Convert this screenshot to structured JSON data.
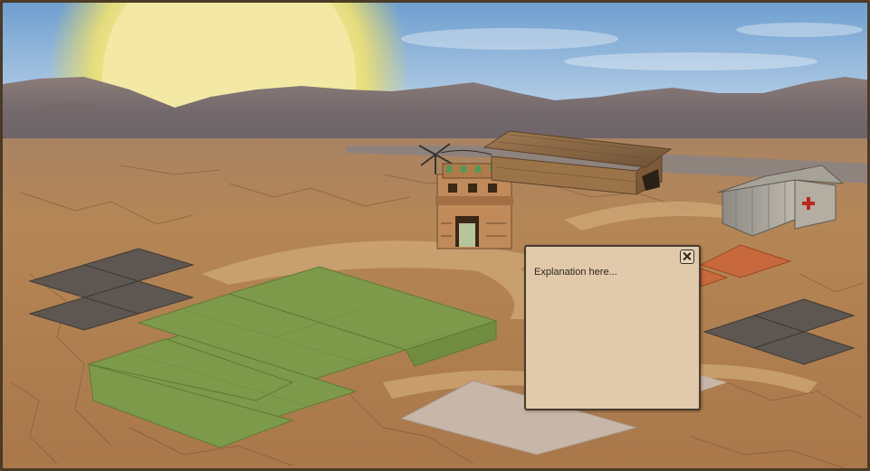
{
  "scene": {
    "sky_color": "#8fb3d9",
    "sun_color": "#f2e58a",
    "ground_color": "#b07f4e",
    "crop_color": "#7d9a4a",
    "stone_color": "#5e5650",
    "brick_color": "#c8683d",
    "gravel_color": "#c8b6a8",
    "objects": [
      "sun",
      "mountains",
      "road",
      "crop-field",
      "stone-plots",
      "brick-plot",
      "gravel-plot",
      "watch-tower",
      "barn",
      "medical-tent",
      "windmill"
    ]
  },
  "explanation_popup": {
    "text": "Explanation here...",
    "close_icon": "close-x-icon"
  }
}
